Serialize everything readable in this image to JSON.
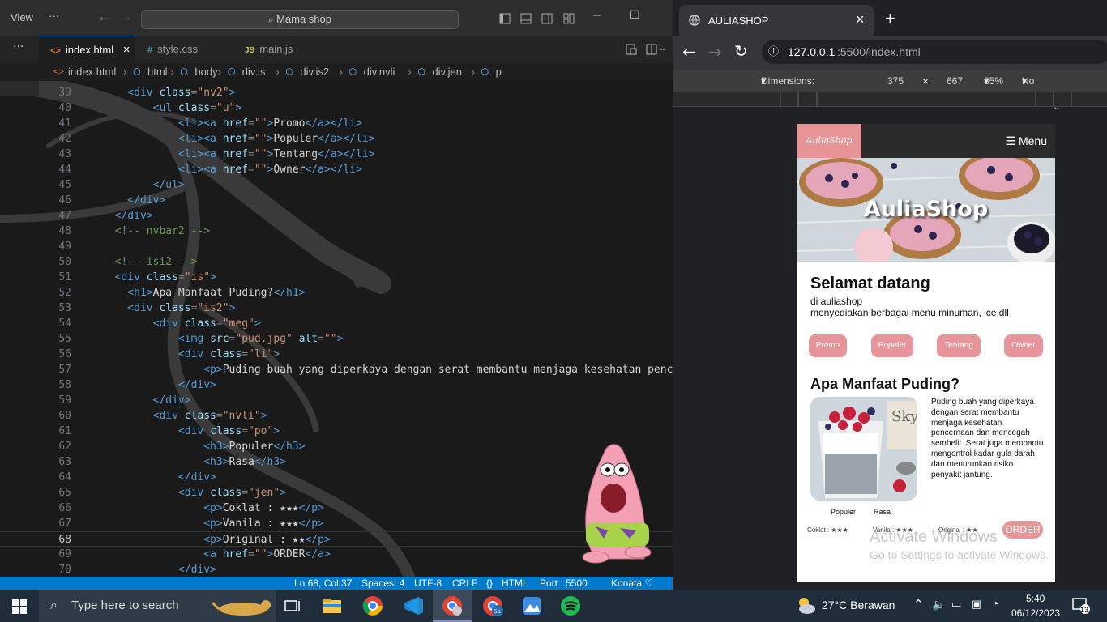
{
  "vscode": {
    "menu_view": "View",
    "menu_more": "···",
    "command_center": "Mama shop",
    "tabs": [
      {
        "label": "index.html",
        "icon": "<>",
        "active": true,
        "close": "×"
      },
      {
        "label": "style.css",
        "icon": "#"
      },
      {
        "label": "main.js",
        "icon": "JS"
      }
    ],
    "breadcrumb": [
      "index.html",
      "html",
      "body",
      "div.is",
      "div.is2",
      "div.nvli",
      "div.jen",
      "p"
    ],
    "lines": [
      {
        "n": "39",
        "segs": [
          [
            "tg",
            "    <div "
          ],
          [
            "at",
            "class"
          ],
          [
            "pu",
            "="
          ],
          [
            "st",
            "\"nv2\""
          ],
          [
            "tg",
            ">"
          ]
        ]
      },
      {
        "n": "40",
        "segs": [
          [
            "tg",
            "        <ul "
          ],
          [
            "at",
            "class"
          ],
          [
            "pu",
            "="
          ],
          [
            "st",
            "\"u\""
          ],
          [
            "tg",
            ">"
          ]
        ]
      },
      {
        "n": "41",
        "segs": [
          [
            "tg",
            "            <li><a "
          ],
          [
            "at",
            "href"
          ],
          [
            "pu",
            "="
          ],
          [
            "st",
            "\"\""
          ],
          [
            "tg",
            ">"
          ],
          [
            "tx",
            "Promo"
          ],
          [
            "tg",
            "</a></li>"
          ]
        ]
      },
      {
        "n": "42",
        "segs": [
          [
            "tg",
            "            <li><a "
          ],
          [
            "at",
            "href"
          ],
          [
            "pu",
            "="
          ],
          [
            "st",
            "\"\""
          ],
          [
            "tg",
            ">"
          ],
          [
            "tx",
            "Populer"
          ],
          [
            "tg",
            "</a></li>"
          ]
        ]
      },
      {
        "n": "43",
        "segs": [
          [
            "tg",
            "            <li><a "
          ],
          [
            "at",
            "href"
          ],
          [
            "pu",
            "="
          ],
          [
            "st",
            "\"\""
          ],
          [
            "tg",
            ">"
          ],
          [
            "tx",
            "Tentang"
          ],
          [
            "tg",
            "</a></li>"
          ]
        ]
      },
      {
        "n": "44",
        "segs": [
          [
            "tg",
            "            <li><a "
          ],
          [
            "at",
            "href"
          ],
          [
            "pu",
            "="
          ],
          [
            "st",
            "\"\""
          ],
          [
            "tg",
            ">"
          ],
          [
            "tx",
            "Owner"
          ],
          [
            "tg",
            "</a></li>"
          ]
        ]
      },
      {
        "n": "45",
        "segs": [
          [
            "tg",
            "        </ul>"
          ]
        ]
      },
      {
        "n": "46",
        "segs": [
          [
            "tg",
            "    </div>"
          ]
        ]
      },
      {
        "n": "47",
        "segs": [
          [
            "tg",
            "  </div>"
          ]
        ]
      },
      {
        "n": "48",
        "segs": [
          [
            "cm",
            "  <!-- nvbar2 -->"
          ]
        ]
      },
      {
        "n": "49",
        "segs": [
          [
            "tx",
            ""
          ]
        ]
      },
      {
        "n": "50",
        "segs": [
          [
            "cm",
            "  <!-- isi2 -->"
          ]
        ]
      },
      {
        "n": "51",
        "segs": [
          [
            "tg",
            "  <div "
          ],
          [
            "at",
            "class"
          ],
          [
            "pu",
            "="
          ],
          [
            "st",
            "\"is\""
          ],
          [
            "tg",
            ">"
          ]
        ]
      },
      {
        "n": "52",
        "segs": [
          [
            "tg",
            "    <h1>"
          ],
          [
            "tx",
            "Apa Manfaat Puding?"
          ],
          [
            "tg",
            "</h1>"
          ]
        ]
      },
      {
        "n": "53",
        "segs": [
          [
            "tg",
            "    <div "
          ],
          [
            "at",
            "class"
          ],
          [
            "pu",
            "="
          ],
          [
            "st",
            "\"is2\""
          ],
          [
            "tg",
            ">"
          ]
        ]
      },
      {
        "n": "54",
        "segs": [
          [
            "tg",
            "        <div "
          ],
          [
            "at",
            "class"
          ],
          [
            "pu",
            "="
          ],
          [
            "st",
            "\"meg\""
          ],
          [
            "tg",
            ">"
          ]
        ]
      },
      {
        "n": "55",
        "segs": [
          [
            "tg",
            "            <img "
          ],
          [
            "at",
            "src"
          ],
          [
            "pu",
            "="
          ],
          [
            "st",
            "\"pud.jpg\""
          ],
          [
            "tx",
            " "
          ],
          [
            "at",
            "alt"
          ],
          [
            "pu",
            "="
          ],
          [
            "st",
            "\"\""
          ],
          [
            "tg",
            ">"
          ]
        ]
      },
      {
        "n": "56",
        "segs": [
          [
            "tg",
            "            <div "
          ],
          [
            "at",
            "class"
          ],
          [
            "pu",
            "="
          ],
          [
            "st",
            "\"li\""
          ],
          [
            "tg",
            ">"
          ]
        ]
      },
      {
        "n": "57",
        "segs": [
          [
            "tg",
            "                <p>"
          ],
          [
            "tx",
            "Puding buah yang diperkaya dengan serat membantu menjaga kesehatan penc"
          ]
        ]
      },
      {
        "n": "58",
        "segs": [
          [
            "tg",
            "            </div>"
          ]
        ]
      },
      {
        "n": "59",
        "segs": [
          [
            "tg",
            "        </div>"
          ]
        ]
      },
      {
        "n": "60",
        "segs": [
          [
            "tg",
            "        <div "
          ],
          [
            "at",
            "class"
          ],
          [
            "pu",
            "="
          ],
          [
            "st",
            "\"nvli\""
          ],
          [
            "tg",
            ">"
          ]
        ]
      },
      {
        "n": "61",
        "segs": [
          [
            "tg",
            "            <div "
          ],
          [
            "at",
            "class"
          ],
          [
            "pu",
            "="
          ],
          [
            "st",
            "\"po\""
          ],
          [
            "tg",
            ">"
          ]
        ]
      },
      {
        "n": "62",
        "segs": [
          [
            "tg",
            "                <h3>"
          ],
          [
            "tx",
            "Populer"
          ],
          [
            "tg",
            "</h3>"
          ]
        ]
      },
      {
        "n": "63",
        "segs": [
          [
            "tg",
            "                <h3>"
          ],
          [
            "tx",
            "Rasa"
          ],
          [
            "tg",
            "</h3>"
          ]
        ]
      },
      {
        "n": "64",
        "segs": [
          [
            "tg",
            "            </div>"
          ]
        ]
      },
      {
        "n": "65",
        "segs": [
          [
            "tg",
            "            <div "
          ],
          [
            "at",
            "class"
          ],
          [
            "pu",
            "="
          ],
          [
            "st",
            "\"jen\""
          ],
          [
            "tg",
            ">"
          ]
        ]
      },
      {
        "n": "66",
        "segs": [
          [
            "tg",
            "                <p>"
          ],
          [
            "tx",
            "Coklat : ★★★"
          ],
          [
            "tg",
            "</p>"
          ]
        ]
      },
      {
        "n": "67",
        "segs": [
          [
            "tg",
            "                <p>"
          ],
          [
            "tx",
            "Vanila : ★★★"
          ],
          [
            "tg",
            "</p>"
          ]
        ]
      },
      {
        "n": "68",
        "segs": [
          [
            "tg",
            "                <p>"
          ],
          [
            "tx",
            "Original : ★★"
          ],
          [
            "tg",
            "</p>"
          ]
        ],
        "current": true
      },
      {
        "n": "69",
        "segs": [
          [
            "tg",
            "                <a "
          ],
          [
            "at",
            "href"
          ],
          [
            "pu",
            "="
          ],
          [
            "st",
            "\"\""
          ],
          [
            "tg",
            ">"
          ],
          [
            "tx",
            "ORDER"
          ],
          [
            "tg",
            "</a>"
          ]
        ]
      },
      {
        "n": "70",
        "segs": [
          [
            "tg",
            "            </div>"
          ]
        ]
      }
    ],
    "status": {
      "position": "Ln 68, Col 37",
      "spaces": "Spaces: 4",
      "encoding": "UTF-8",
      "eol": "CRLF",
      "language": "HTML",
      "port": "Port : 5500",
      "user": "Konata ♡"
    }
  },
  "browser": {
    "tab_title": "AULIASHOP",
    "tab_close": "×",
    "new_tab": "+",
    "url_host": "127.0.0.1",
    "url_rest": ":5500/index.html",
    "device": "Dimensions: iPhone SE",
    "width": "375",
    "times": "×",
    "height": "667",
    "zoom": "85%",
    "throttle": "No throttling"
  },
  "page": {
    "logo": "AuliaShop",
    "menu": "☰ Menu",
    "hero_title": "AuliaShop",
    "welcome": "Selamat datang",
    "sub1": "di auliashop",
    "sub2": "menyediakan berbagai menu minuman, ice dll",
    "nav": [
      "Promo",
      "Populer",
      "Tentang",
      "Owner"
    ],
    "heading": "Apa Manfaat Puding?",
    "paragraph": "Puding buah yang diperkaya dengan serat membantu menjaga kesehatan pencernaan dan mencegah sembelit. Serat juga membantu mengontrol kadar gula darah dan menurunkan risiko penyakit jantung.",
    "tags": [
      "Populer",
      "Rasa"
    ],
    "ratings": [
      "Coklat : ★★★",
      "Vanila : ★★★",
      "Original : ★★"
    ],
    "order": "ORDER",
    "pud_brand": "Sky"
  },
  "watermark": {
    "line1": "Activate Windows",
    "line2": "Go to Settings to activate Windows."
  },
  "taskbar": {
    "search_placeholder": "Type here to search",
    "weather": "27°C  Berawan",
    "time": "5:40",
    "date": "06/12/2023",
    "notif": "13"
  },
  "colors": {
    "accent_pink": "#e8959a",
    "vscode_status": "#007acc"
  }
}
